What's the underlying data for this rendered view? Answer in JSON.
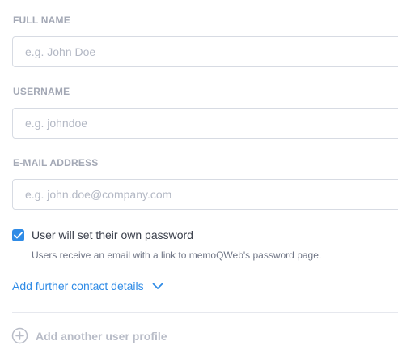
{
  "fields": [
    {
      "label": "FULL NAME",
      "placeholder": "e.g. John Doe",
      "value": ""
    },
    {
      "label": "USERNAME",
      "placeholder": "e.g. johndoe",
      "value": ""
    },
    {
      "label": "E-MAIL ADDRESS",
      "placeholder": "e.g. john.doe@company.com",
      "value": ""
    }
  ],
  "password_option": {
    "checked": true,
    "label": "User will set their own password",
    "helper": "Users receive an email with a link to memoQWeb's password page."
  },
  "contact_link": {
    "label": "Add further contact details",
    "icon": "chevron-down-icon"
  },
  "add_profile": {
    "label": "Add another user profile",
    "icon": "plus-circle-icon"
  },
  "colors": {
    "accent": "#2f8be6",
    "label": "#a3a8b5",
    "text": "#3a3f4b",
    "muted": "#b8bcc7"
  }
}
